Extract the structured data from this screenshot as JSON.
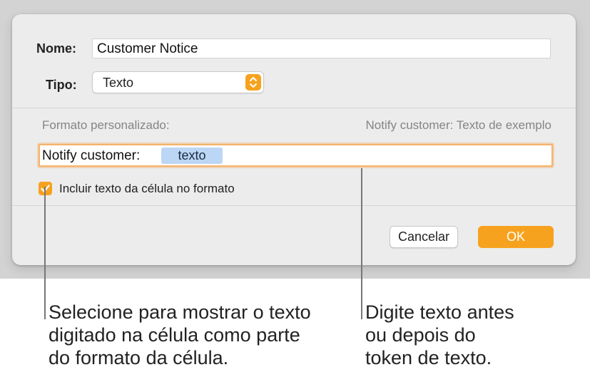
{
  "dialog": {
    "name_label": "Nome:",
    "name_value": "Customer Notice",
    "type_label": "Tipo:",
    "type_value": "Texto",
    "format_label": "Formato personalizado:",
    "sample_text": "Notify customer: Texto de exemplo",
    "format_prefix": "Notify customer:",
    "token_label": "texto",
    "checkbox_label": "Incluir texto da célula no formato",
    "checkbox_checked": true,
    "cancel_label": "Cancelar",
    "ok_label": "OK"
  },
  "callouts": {
    "left": [
      "Selecione para mostrar o texto",
      "digitado na célula como parte",
      "do formato da célula."
    ],
    "right": [
      "Digite texto antes",
      "ou depois do",
      "token de texto."
    ]
  },
  "colors": {
    "accent": "#F7A21E",
    "token_bg": "#BCD6F5",
    "focus_ring": "#F6B26B",
    "dialog_bg": "#ECECEC",
    "backdrop": "#D3D3D3"
  },
  "icons": {
    "stepper": "up-down-chevron-icon",
    "checkbox": "checkmark-icon"
  }
}
